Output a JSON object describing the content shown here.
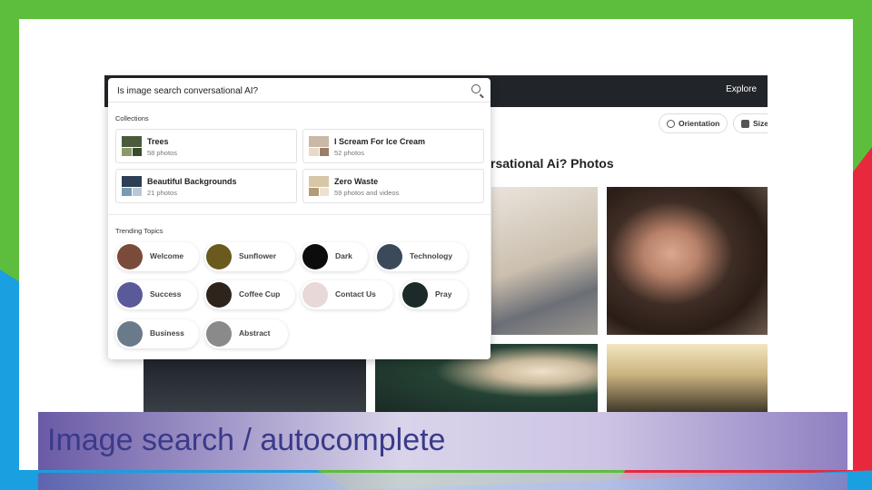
{
  "app": {
    "nav": {
      "explore_label": "Explore"
    },
    "filters": {
      "orientation_label": "Orientation",
      "size_label": "Size"
    },
    "results_title": "rsational Ai? Photos"
  },
  "search": {
    "value": "Is image search conversational AI?",
    "icon": "search-icon"
  },
  "collections": {
    "heading": "Collections",
    "items": [
      {
        "title": "Trees",
        "count": "58 photos",
        "colors": [
          "#4a5a3c",
          "#8a9a6a",
          "#3a4a2e"
        ]
      },
      {
        "title": "I Scream For Ice Cream",
        "count": "52 photos",
        "colors": [
          "#c9b8a6",
          "#e8d9c8",
          "#9a7e6a"
        ]
      },
      {
        "title": "Beautiful Backgrounds",
        "count": "21 photos",
        "colors": [
          "#2d3e55",
          "#7a9ab4",
          "#b8c8d6"
        ]
      },
      {
        "title": "Zero Waste",
        "count": "59 photos and videos",
        "colors": [
          "#d8c6a8",
          "#b39a78",
          "#ece2d2"
        ]
      }
    ]
  },
  "trending": {
    "heading": "Trending Topics",
    "topics": [
      {
        "label": "Welcome",
        "color": "#7a4a3a"
      },
      {
        "label": "Sunflower",
        "color": "#6a5a1e"
      },
      {
        "label": "Dark",
        "color": "#0c0c0c"
      },
      {
        "label": "Technology",
        "color": "#3a4a5a"
      },
      {
        "label": "Success",
        "color": "#5a5a9a"
      },
      {
        "label": "Coffee Cup",
        "color": "#2e241c"
      },
      {
        "label": "Contact Us",
        "color": "#e8d8d8"
      },
      {
        "label": "Pray",
        "color": "#1c2a2a"
      },
      {
        "label": "Business",
        "color": "#6a7a8a"
      },
      {
        "label": "Abstract",
        "color": "#8a8a8a"
      }
    ]
  },
  "caption": {
    "text": "Image search / autocomplete"
  }
}
